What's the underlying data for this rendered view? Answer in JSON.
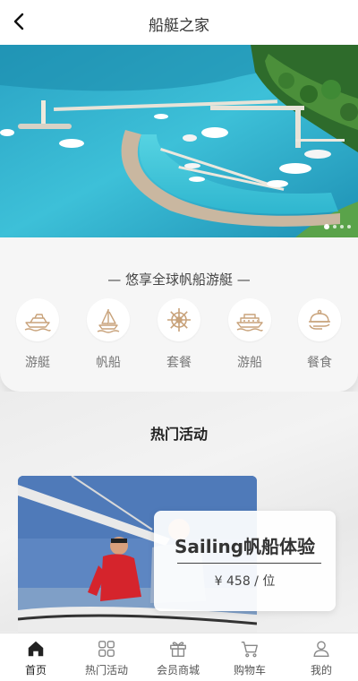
{
  "header": {
    "title": "船艇之家",
    "back_icon": "chevron-left-icon"
  },
  "banner": {
    "slide_count": 4,
    "active_slide": 1
  },
  "categories": {
    "heading": "—  悠享全球帆船游艇  —",
    "items": [
      {
        "label": "游艇",
        "icon": "yacht-icon"
      },
      {
        "label": "帆船",
        "icon": "sailboat-icon"
      },
      {
        "label": "套餐",
        "icon": "ship-wheel-icon"
      },
      {
        "label": "游船",
        "icon": "cruise-ship-icon"
      },
      {
        "label": "餐食",
        "icon": "food-cloche-icon"
      }
    ],
    "icon_color": "#c8a27a"
  },
  "hot": {
    "title": "热门活动",
    "activity": {
      "title": "Sailing帆船体验",
      "price": "¥ 458 / 位"
    }
  },
  "tabbar": {
    "items": [
      {
        "label": "首页",
        "icon": "home-icon",
        "active": true
      },
      {
        "label": "热门活动",
        "icon": "grid-icon",
        "active": false
      },
      {
        "label": "会员商城",
        "icon": "gift-icon",
        "active": false
      },
      {
        "label": "购物车",
        "icon": "cart-icon",
        "active": false
      },
      {
        "label": "我的",
        "icon": "user-icon",
        "active": false
      }
    ]
  }
}
